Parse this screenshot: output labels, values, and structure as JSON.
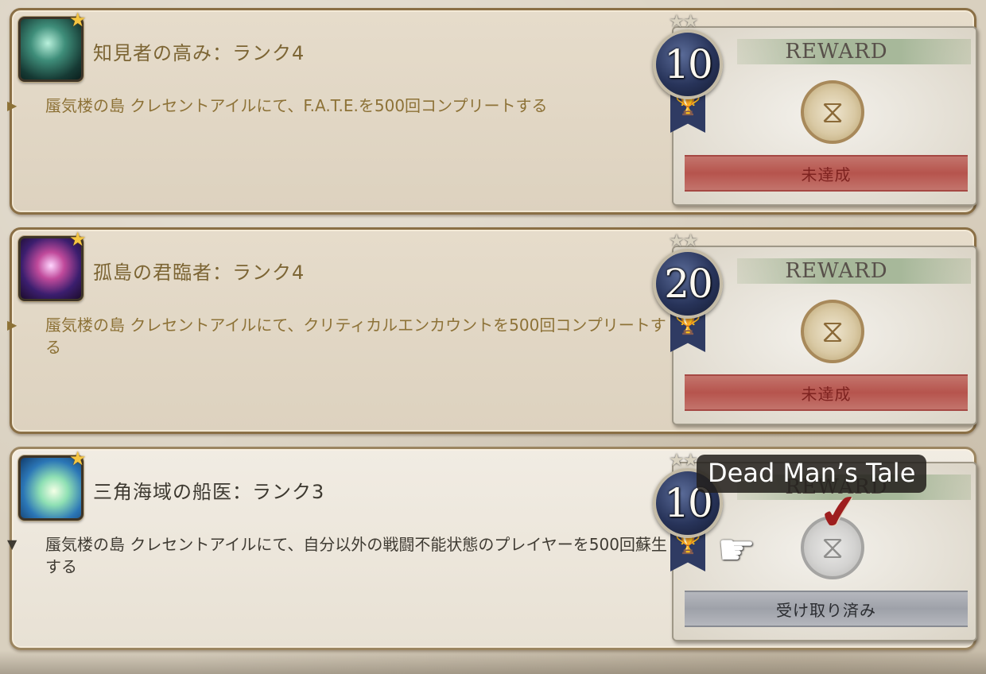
{
  "achievements": [
    {
      "title": "知見者の高み：ランク4",
      "arrow": "▶",
      "description": "蜃気楼の島 クレセントアイルにて、F.A.T.E.を500回コンプリートする",
      "points": "10",
      "stars": "★★",
      "reward_label": "REWARD",
      "status": "未達成",
      "icon": "achievement-knowledge-icon"
    },
    {
      "title": "孤島の君臨者：ランク4",
      "arrow": "▶",
      "description": "蜃気楼の島 クレセントアイルにて、クリティカルエンカウントを500回コンプリートする",
      "points": "20",
      "stars": "★★",
      "reward_label": "REWARD",
      "status": "未達成",
      "icon": "achievement-sovereign-icon"
    },
    {
      "title": "三角海域の船医：ランク3",
      "arrow": "▼",
      "description": "蜃気楼の島 クレセントアイルにて、自分以外の戦闘不能状態のプレイヤーを500回蘇生する",
      "points": "10",
      "stars": "★★",
      "reward_label": "REWARD",
      "status": "受け取り済み",
      "icon": "achievement-ship-doctor-icon"
    }
  ],
  "tooltip": {
    "text": "Dead Man’s Tale"
  },
  "icons": {
    "star": "★",
    "trophy": "🏆",
    "token_glyph": "⧖",
    "check": "✔",
    "pointer": "☛"
  },
  "colors": {
    "unmet_status": "#b6544d",
    "claimed_status": "#9ea1a9",
    "title_gold": "#7c6534",
    "badge_blue": "#28345a"
  }
}
